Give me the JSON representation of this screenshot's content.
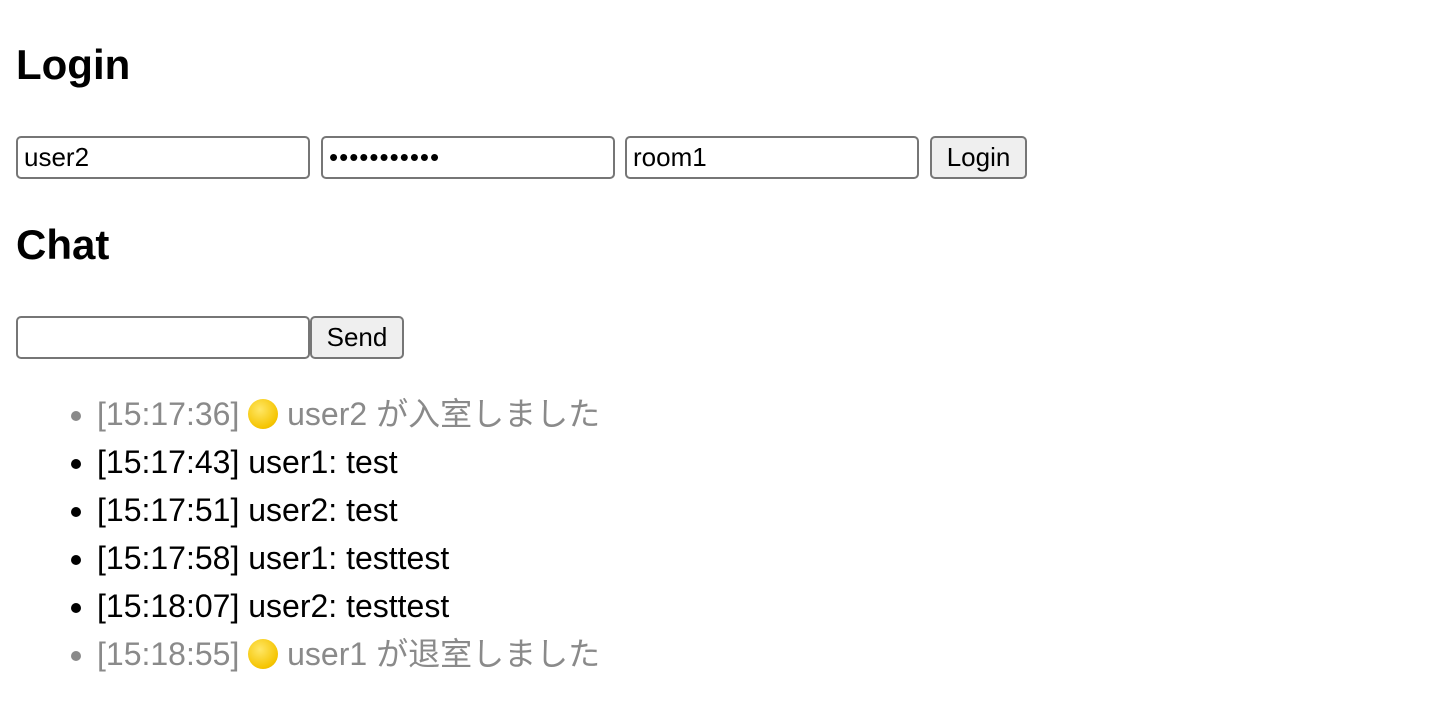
{
  "login": {
    "heading": "Login",
    "username_value": "user2",
    "password_value": "•••••••••••",
    "room_value": "room1",
    "login_button_label": "Login"
  },
  "chat": {
    "heading": "Chat",
    "message_value": "",
    "send_button_label": "Send",
    "messages": [
      {
        "time": "[15:17:36]",
        "icon": "yellow-circle-icon",
        "text": "user2 が入室しました",
        "system": true
      },
      {
        "time": "[15:17:43]",
        "text": "user1: test",
        "system": false
      },
      {
        "time": "[15:17:51]",
        "text": "user2: test",
        "system": false
      },
      {
        "time": "[15:17:58]",
        "text": "user1: testtest",
        "system": false
      },
      {
        "time": "[15:18:07]",
        "text": "user2: testtest",
        "system": false
      },
      {
        "time": "[15:18:55]",
        "icon": "yellow-circle-icon",
        "text": "user1 が退室しました",
        "system": true
      }
    ]
  },
  "colors": {
    "system_text": "#8a8a8a",
    "button_bg": "#efefef",
    "input_border": "#767676"
  }
}
